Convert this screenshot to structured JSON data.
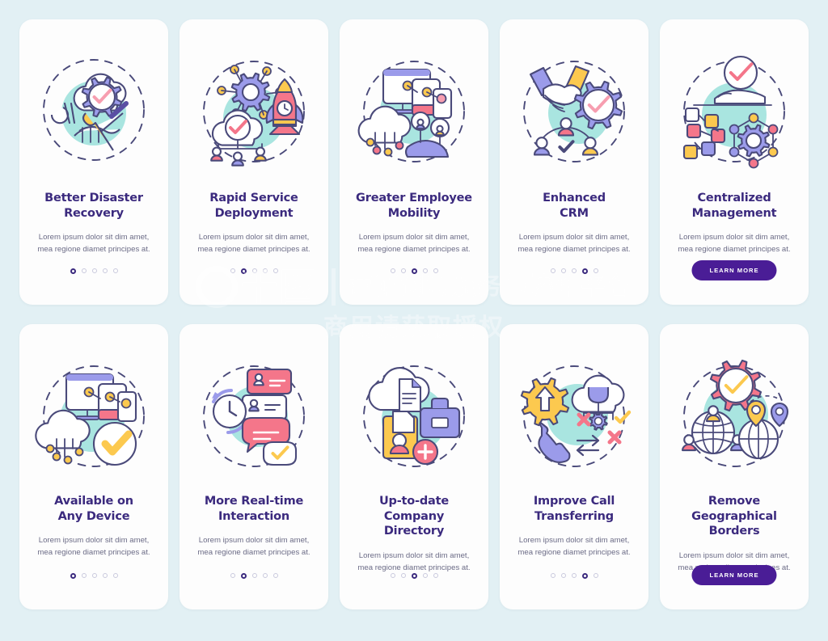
{
  "page": {
    "background": "#e2f0f4",
    "title_color": "#3b2a7e",
    "desc_color": "#6b6b86",
    "button_color": "#4a1d96"
  },
  "watermark": {
    "logo_text": "千图",
    "tagline": "营销创意服务与协作平台",
    "line2": "商用请获取授权"
  },
  "cards": [
    {
      "id": "better-disaster-recovery",
      "title": "Better Disaster\nRecovery",
      "desc": "Lorem ipsum dolor sit dim amet, mea regione diamet principes at.",
      "footer": "dots",
      "dots": {
        "count": 5,
        "active": 0
      },
      "illustration": "handshake-cloud-gear-wrench"
    },
    {
      "id": "rapid-service-deployment",
      "title": "Rapid Service\nDeployment",
      "desc": "Lorem ipsum dolor sit dim amet, mea regione diamet principes at.",
      "footer": "dots",
      "dots": {
        "count": 5,
        "active": 1
      },
      "illustration": "gear-rocket-cloud-users"
    },
    {
      "id": "greater-employee-mobility",
      "title": "Greater Employee\nMobility",
      "desc": "Lorem ipsum dolor sit dim amet, mea regione diamet principes at.",
      "footer": "dots",
      "dots": {
        "count": 5,
        "active": 2
      },
      "illustration": "devices-cloud-globe-users"
    },
    {
      "id": "enhanced-crm",
      "title": "Enhanced\nCRM",
      "desc": "Lorem ipsum dolor sit dim amet, mea regione diamet principes at.",
      "footer": "dots",
      "dots": {
        "count": 5,
        "active": 3
      },
      "illustration": "handshake-gear-check-users"
    },
    {
      "id": "centralized-management",
      "title": "Centralized\nManagement",
      "desc": "Lorem ipsum dolor sit dim amet, mea regione diamet principes at.",
      "footer": "button",
      "button_label": "LEARN MORE",
      "illustration": "hand-check-nodes-gear"
    },
    {
      "id": "available-on-any-device",
      "title": "Available on\nAny Device",
      "desc": "Lorem ipsum dolor sit dim amet, mea regione diamet principes at.",
      "footer": "dots",
      "dots": {
        "count": 5,
        "active": 0
      },
      "illustration": "monitor-tablet-phone-cloud-check"
    },
    {
      "id": "more-real-time-interaction",
      "title": "More Real-time\nInteraction",
      "desc": "Lorem ipsum dolor sit dim amet, mea regione diamet principes at.",
      "footer": "dots",
      "dots": {
        "count": 5,
        "active": 1
      },
      "illustration": "chat-bubbles-clock-check"
    },
    {
      "id": "up-to-date-company-directory",
      "title": "Up-to-date\nCompany\nDirectory",
      "desc": "Lorem ipsum dolor sit dim amet, mea regione diamet principes at.",
      "footer": "dots",
      "dots": {
        "count": 5,
        "active": 2
      },
      "illustration": "cloud-document-briefcase-profile-add"
    },
    {
      "id": "improve-call-transferring",
      "title": "Improve Call\nTransferring",
      "desc": "Lorem ipsum dolor sit dim amet, mea regione diamet principes at.",
      "footer": "dots",
      "dots": {
        "count": 5,
        "active": 3
      },
      "illustration": "gear-arrow-phone-cloud-transfer"
    },
    {
      "id": "remove-geographical-borders",
      "title": "Remove\nGeographical\nBorders",
      "desc": "Lorem ipsum dolor sit dim amet, mea regione diamet principes at.",
      "footer": "button",
      "button_label": "LEARN MORE",
      "illustration": "gear-check-globe-users-pins"
    }
  ],
  "palette": {
    "purple": "#9b9bea",
    "purple_dark": "#5a4fa3",
    "outline": "#4a4a7a",
    "teal": "#a9e5e0",
    "pink": "#f4768a",
    "pink_light": "#f79eb0",
    "yellow": "#fcc94f",
    "white": "#ffffff"
  }
}
